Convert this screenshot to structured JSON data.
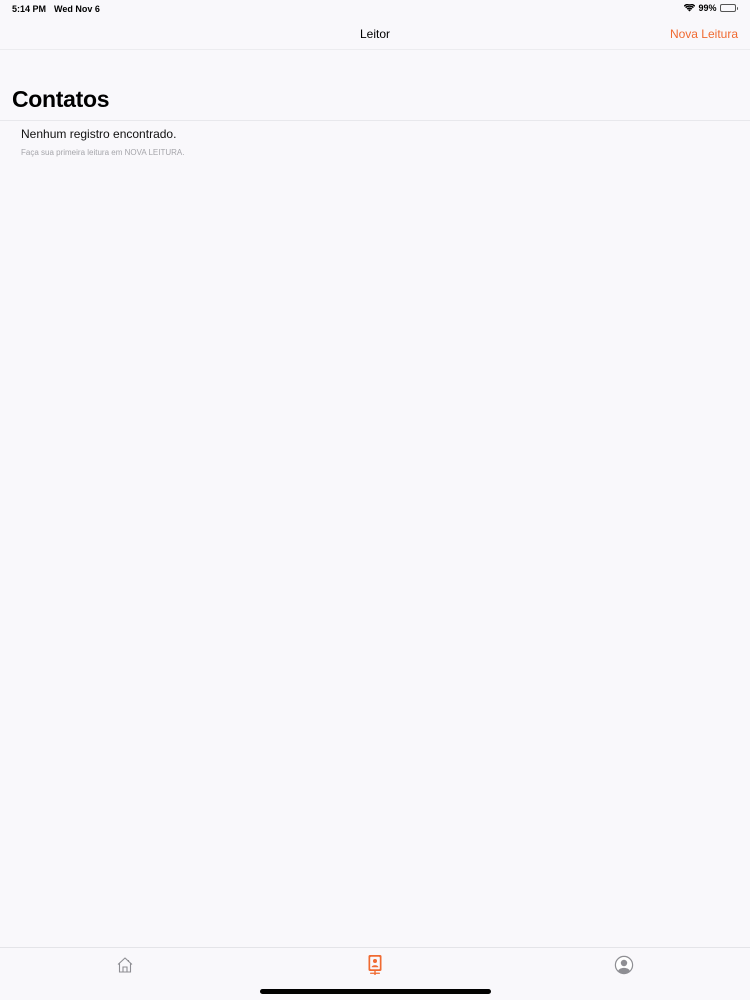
{
  "status_bar": {
    "time": "5:14 PM",
    "date": "Wed Nov 6",
    "battery": "99%"
  },
  "nav": {
    "title": "Leitor",
    "action_label": "Nova Leitura"
  },
  "page": {
    "title": "Contatos"
  },
  "empty_state": {
    "title": "Nenhum registro encontrado.",
    "subtitle": "Faça sua primeira leitura em NOVA LEITURA."
  },
  "tab_bar": {
    "items": [
      {
        "icon": "home-icon",
        "active": false
      },
      {
        "icon": "contact-card-icon",
        "active": true
      },
      {
        "icon": "profile-icon",
        "active": false
      }
    ],
    "active_color": "#f06a31",
    "inactive_color": "#8e8e93"
  },
  "colors": {
    "accent": "#f06a31",
    "background": "#f9f8fb"
  }
}
